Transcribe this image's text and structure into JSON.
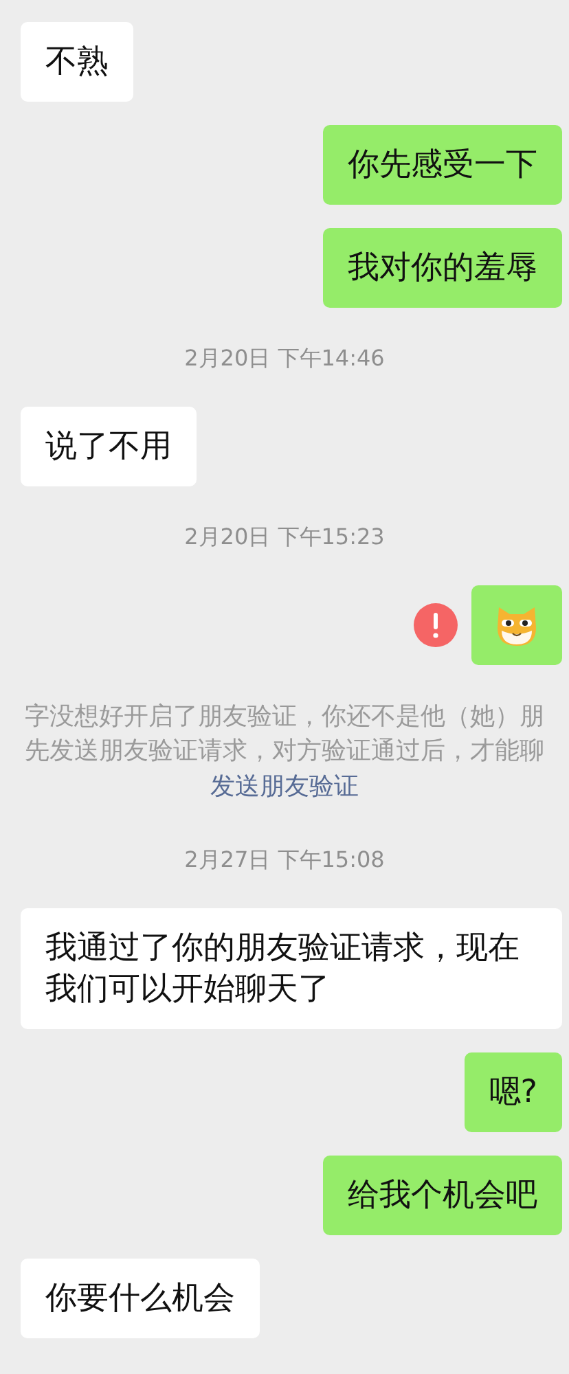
{
  "messages": [
    {
      "kind": "received",
      "text": "不熟"
    },
    {
      "kind": "sent",
      "text": "你先感受一下"
    },
    {
      "kind": "sent",
      "text": "我对你的羞辱"
    },
    {
      "kind": "time",
      "text": "2月20日 下午14:46"
    },
    {
      "kind": "received",
      "text": "说了不用"
    },
    {
      "kind": "time",
      "text": "2月20日 下午15:23"
    },
    {
      "kind": "sticker",
      "failed": true
    },
    {
      "kind": "notice",
      "lines": [
        "字没想好开启了朋友验证，你还不是他（她）朋",
        "先发送朋友验证请求，对方验证通过后，才能聊"
      ],
      "link": "发送朋友验证"
    },
    {
      "kind": "time",
      "text": "2月27日 下午15:08"
    },
    {
      "kind": "received",
      "text": "我通过了你的朋友验证请求，现在我们可以开始聊天了"
    },
    {
      "kind": "sent",
      "text": "嗯?"
    },
    {
      "kind": "sent",
      "text": "给我个机会吧"
    },
    {
      "kind": "received",
      "text": "你要什么机会"
    }
  ]
}
